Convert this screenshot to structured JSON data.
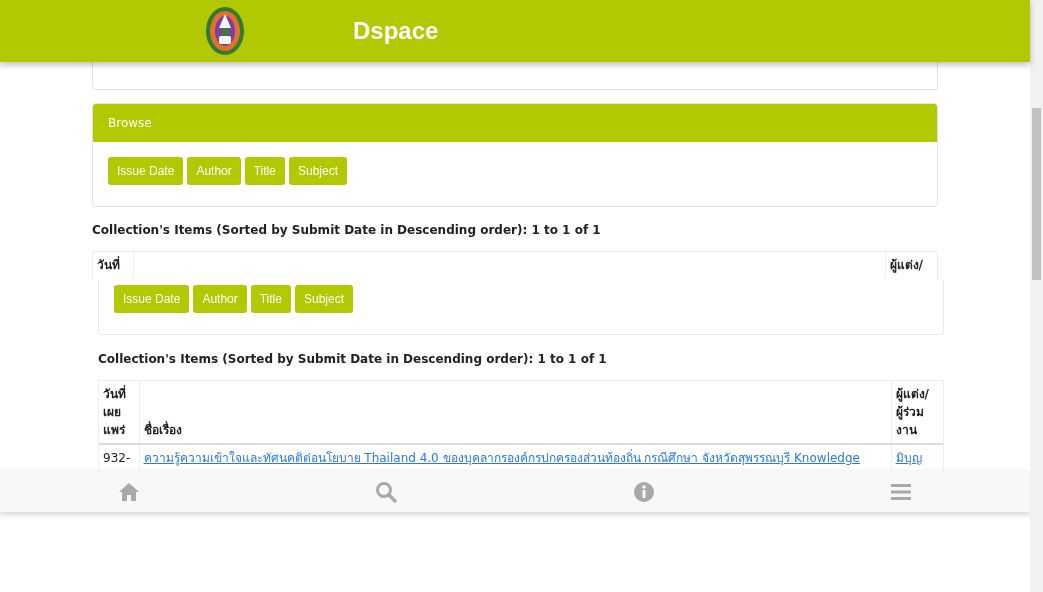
{
  "header": {
    "title": "Dspace"
  },
  "browse": {
    "title": "Browse",
    "buttons": [
      "Issue Date",
      "Author",
      "Title",
      "Subject"
    ]
  },
  "items_heading": "Collection's Items (Sorted by Submit Date in Descending order): 1 to 1 of 1",
  "table": {
    "columns": [
      "วันที่",
      "",
      "ผู้แต่ง/"
    ]
  },
  "repeat": {
    "buttons": [
      "Issue Date",
      "Author",
      "Title",
      "Subject"
    ],
    "items_heading": "Collection's Items (Sorted by Submit Date in Descending order): 1 to 1 of 1",
    "table": {
      "columns": [
        "วันที่ เผย แพร่",
        "ชื่อเรื่อง",
        "ผู้แต่ง/ ผู้ร่วม งาน"
      ],
      "rows": [
        {
          "date": "932-",
          "title": "ความรู้ความเข้าใจและทัศนคติต่อนโยบาย Thailand 4.0 ของบุคลากรองค์กรปกครองส่วนท้องถิ่น กรณีศึกษา จังหวัดสุพรรณบุรี Knowledge",
          "author": "มิบุญ"
        }
      ]
    }
  },
  "bottom_nav": [
    {
      "kind": "home"
    },
    {
      "kind": "search"
    },
    {
      "kind": "info"
    },
    {
      "kind": "menu"
    }
  ]
}
